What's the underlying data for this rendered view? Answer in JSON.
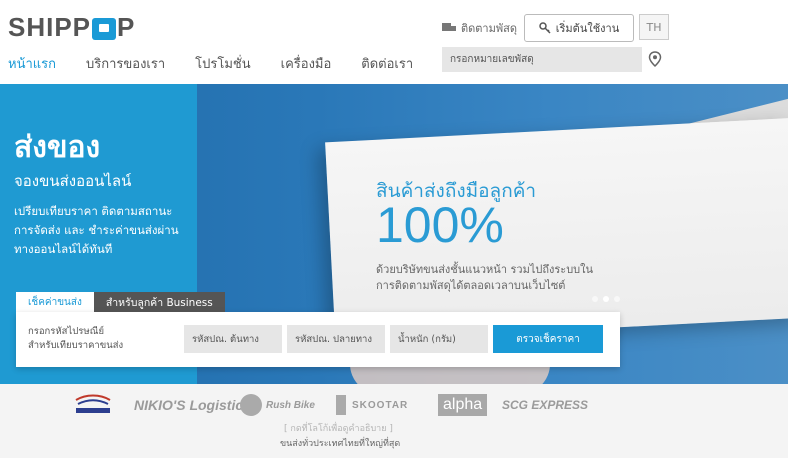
{
  "brand": {
    "logo_prefix": "SHIPP",
    "logo_suffix": "P"
  },
  "nav": {
    "items": [
      {
        "label": "หน้าแรก",
        "active": true
      },
      {
        "label": "บริการของเรา",
        "active": false
      },
      {
        "label": "โปรโมชั่น",
        "active": false
      },
      {
        "label": "เครื่องมือ",
        "active": false
      },
      {
        "label": "ติดต่อเรา",
        "active": false
      }
    ]
  },
  "header": {
    "track_label": "ติดตามพัสดุ",
    "start_label": "เริ่มต้นใช้งาน",
    "lang": "TH",
    "track_placeholder": "กรอกหมายเลขพัสดุ"
  },
  "hero": {
    "title": "ส่งของ",
    "subtitle": "จองขนส่งออนไลน์",
    "description": "เปรียบเทียบราคา ติดตามสถานะการจัดส่ง และ ชำระค่าขนส่งผ่านทางออนไลน์ได้ทันที",
    "box_line1": "สินค้าส่งถึงมือลูกค้า",
    "box_big": "100%",
    "box_line2": "ด้วยบริษัทขนส่งชั้นแนวหน้า รวมไปถึงระบบในการติดตามพัสดุได้ตลอดเวลาบนเว็บไซต์",
    "slide_count": 3,
    "active_slide": 2
  },
  "quote": {
    "tabs": [
      {
        "label": "เช็คค่าขนส่ง",
        "active": true
      },
      {
        "label": "สำหรับลูกค้า Business",
        "active": false
      }
    ],
    "label": "กรอกรหัสไปรษณีย์\nสำหรับเทียบราคาขนส่ง",
    "origin_placeholder": "รหัสปณ. ต้นทาง",
    "dest_placeholder": "รหัสปณ. ปลายทาง",
    "weight_placeholder": "น้ำหนัก (กรัม)",
    "check_label": "ตรวจเช็คราคา"
  },
  "partners": {
    "logos": [
      "Thailand Post",
      "NIKIO'S Logistics",
      "Rush Bike",
      "SKOOTAR",
      "alpha",
      "SCG EXPRESS"
    ],
    "link": "[ กดที่โลโก้เพื่อดูคำอธิบาย ]",
    "tagline": "ขนส่งทั่วประเทศไทยที่ใหญ่ที่สุด"
  },
  "colors": {
    "accent": "#1a9ad6",
    "dark_tab": "#555555"
  }
}
